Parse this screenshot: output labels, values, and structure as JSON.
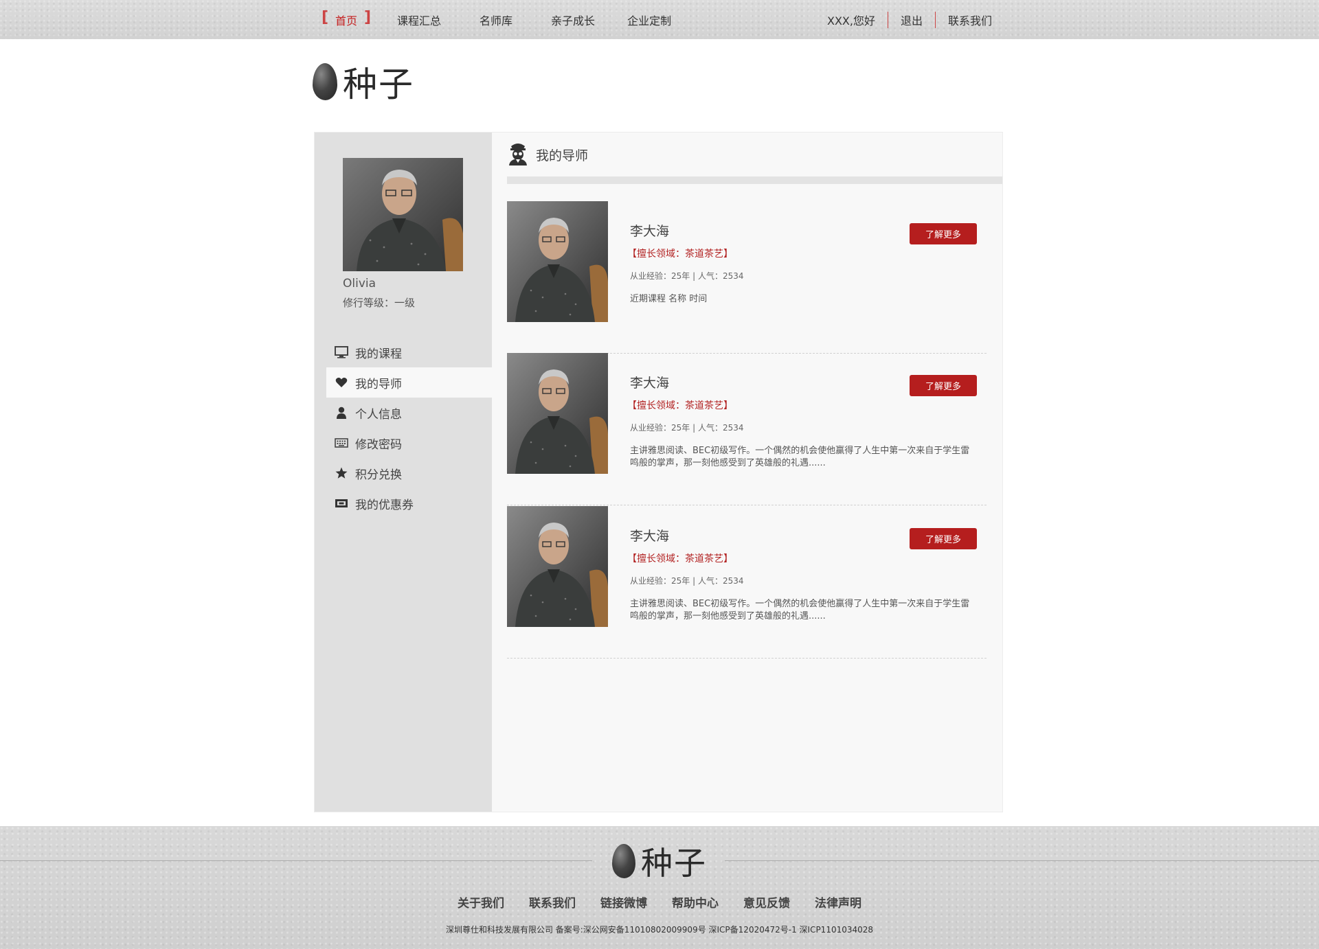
{
  "nav": {
    "left": [
      "首页",
      "课程汇总",
      "名师库",
      "亲子成长",
      "企业定制"
    ],
    "greeting": "XXX,您好",
    "logout": "退出",
    "contact": "联系我们"
  },
  "brand": {
    "name": "种子"
  },
  "user": {
    "name": "Olivia",
    "level": "修行等级：一级"
  },
  "sidebar": {
    "items": [
      {
        "label": "我的课程",
        "icon": "monitor-icon"
      },
      {
        "label": "我的导师",
        "icon": "heart-icon"
      },
      {
        "label": "个人信息",
        "icon": "user-icon"
      },
      {
        "label": "修改密码",
        "icon": "keyboard-icon"
      },
      {
        "label": "积分兑换",
        "icon": "star-icon"
      },
      {
        "label": "我的优惠券",
        "icon": "ticket-icon"
      }
    ],
    "active": "我的导师"
  },
  "section": {
    "title": "我的导师",
    "icon": "mentor-icon"
  },
  "mentors": [
    {
      "name": "李大海",
      "field": "【擅长领域：茶道茶艺】",
      "meta": "从业经验：25年  |  人气：2534",
      "desc": "近期课程   名称   时间",
      "button": "了解更多"
    },
    {
      "name": "李大海",
      "field": "【擅长领域：茶道茶艺】",
      "meta": "从业经验：25年  |  人气：2534",
      "desc": "主讲雅思阅读、BEC初级写作。一个偶然的机会使他赢得了人生中第一次来自于学生雷鸣般的掌声，那一刻他感受到了英雄般的礼遇......",
      "button": "了解更多"
    },
    {
      "name": "李大海",
      "field": "【擅长领域：茶道茶艺】",
      "meta": "从业经验：25年  |  人气：2534",
      "desc": "主讲雅思阅读、BEC初级写作。一个偶然的机会使他赢得了人生中第一次来自于学生雷鸣般的掌声，那一刻他感受到了英雄般的礼遇......",
      "button": "了解更多"
    }
  ],
  "footer": {
    "links": [
      "关于我们",
      "联系我们",
      "链接微博",
      "帮助中心",
      "意见反馈",
      "法律声明"
    ],
    "copyright": "深圳尊仕和科技发展有限公司    备案号:深公网安备11010802009909号 深ICP备12020472号-1 深ICP1101034028"
  },
  "colors": {
    "accent": "#b51e1e",
    "sidebar_bg": "#e0e0e0",
    "panel_bg": "#f8f8f8"
  }
}
